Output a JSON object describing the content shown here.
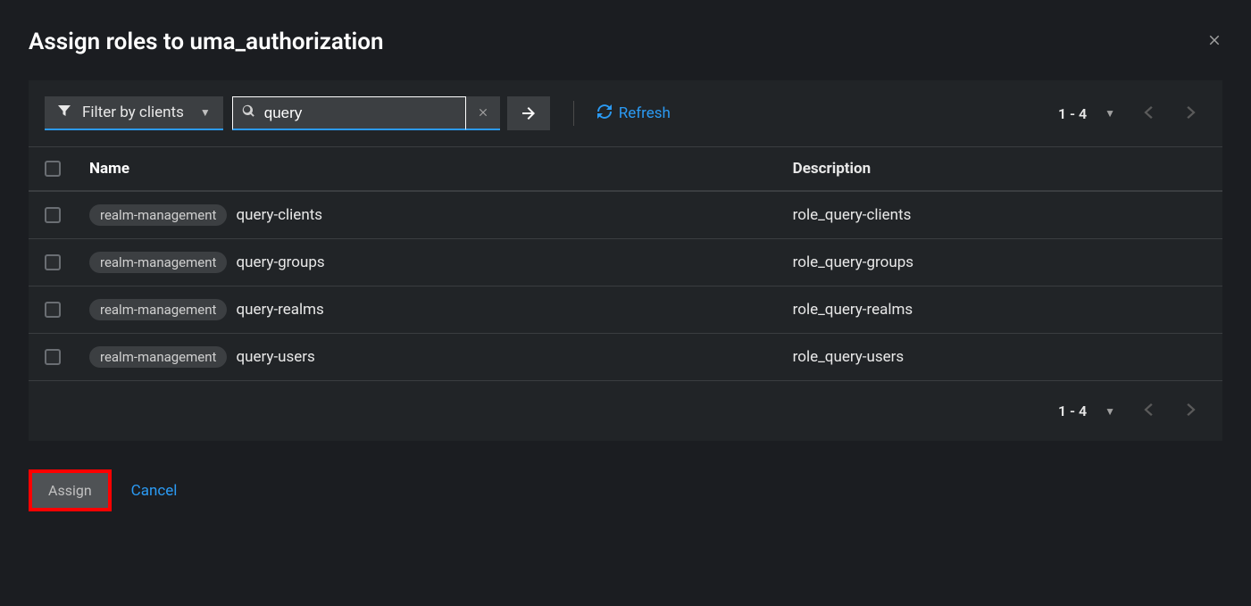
{
  "modal": {
    "title": "Assign roles to uma_authorization"
  },
  "toolbar": {
    "filter_label": "Filter by clients",
    "search_value": "query",
    "refresh_label": "Refresh"
  },
  "pagination": {
    "range": "1 - 4"
  },
  "table": {
    "headers": {
      "name": "Name",
      "description": "Description"
    },
    "rows": [
      {
        "badge": "realm-management",
        "name": "query-clients",
        "description": "role_query-clients"
      },
      {
        "badge": "realm-management",
        "name": "query-groups",
        "description": "role_query-groups"
      },
      {
        "badge": "realm-management",
        "name": "query-realms",
        "description": "role_query-realms"
      },
      {
        "badge": "realm-management",
        "name": "query-users",
        "description": "role_query-users"
      }
    ]
  },
  "footer": {
    "assign_label": "Assign",
    "cancel_label": "Cancel"
  }
}
